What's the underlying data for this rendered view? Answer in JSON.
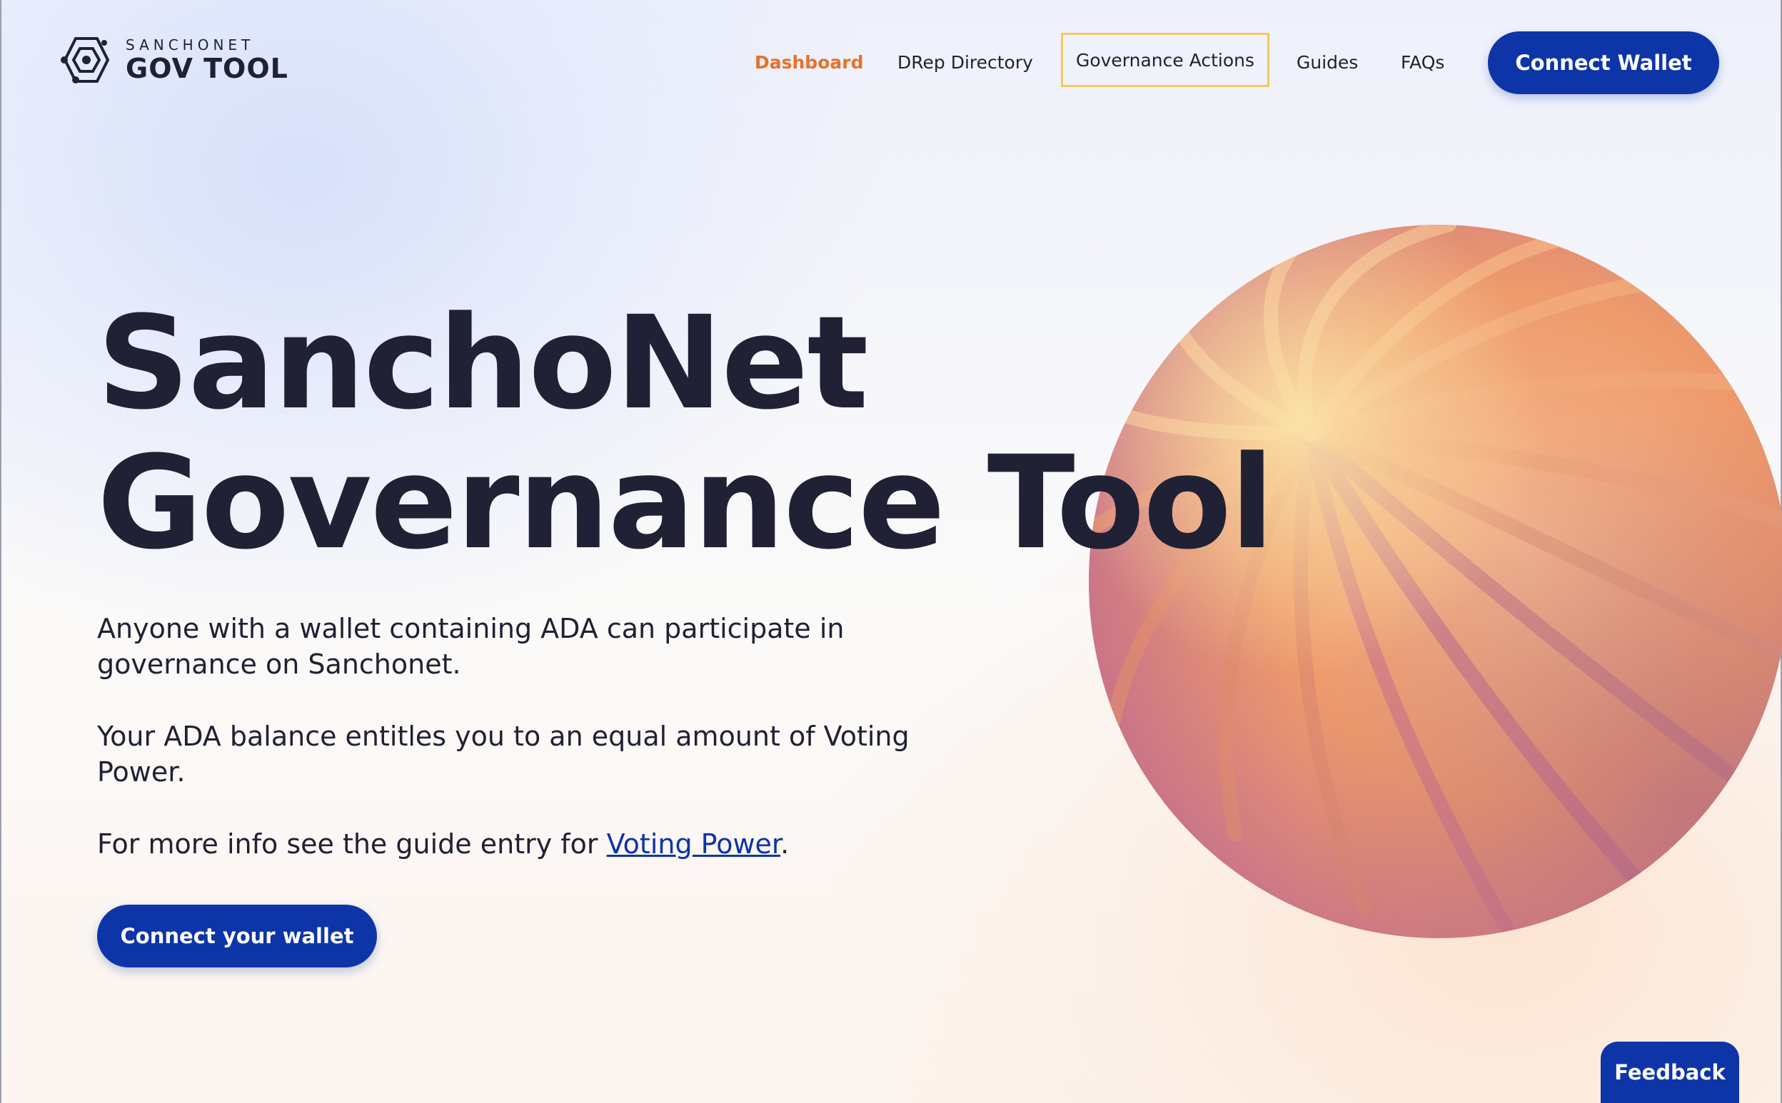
{
  "logo": {
    "small": "SANCHONET",
    "big": "GOV TOOL"
  },
  "nav": {
    "items": [
      {
        "label": "Dashboard",
        "active": true
      },
      {
        "label": "DRep Directory",
        "active": false
      },
      {
        "label": "Governance Actions",
        "active": false,
        "highlighted": true
      },
      {
        "label": "Guides",
        "active": false
      },
      {
        "label": "FAQs",
        "active": false
      }
    ],
    "connect_wallet_label": "Connect Wallet"
  },
  "hero": {
    "title_line1": "SanchoNet",
    "title_line2": "Governance Tool",
    "paragraph1": "Anyone with a wallet containing ADA can participate in governance on Sanchonet.",
    "paragraph2": "Your ADA balance entitles you to an equal amount of Voting Power.",
    "paragraph3_prefix": "For more info see the guide entry for ",
    "paragraph3_link": "Voting Power",
    "paragraph3_suffix": ".",
    "cta_label": "Connect your wallet"
  },
  "feedback": {
    "label": "Feedback"
  },
  "colors": {
    "primary": "#0e35a8",
    "active_nav": "#e8702a",
    "highlight_border": "#f4c85a",
    "text": "#212135",
    "sphere": "#ef9a6a"
  }
}
